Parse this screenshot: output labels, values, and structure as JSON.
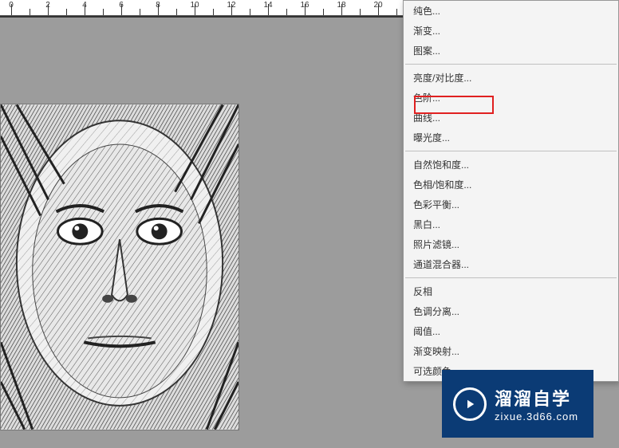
{
  "ruler": {
    "labels": [
      "0",
      "2",
      "4",
      "6",
      "8",
      "10",
      "12",
      "14",
      "16",
      "18",
      "20"
    ]
  },
  "menu": {
    "items": [
      {
        "label": "纯色...",
        "sep": false
      },
      {
        "label": "渐变...",
        "sep": false
      },
      {
        "label": "图案...",
        "sep": true
      },
      {
        "label": "亮度/对比度...",
        "sep": false
      },
      {
        "label": "色阶...",
        "sep": false
      },
      {
        "label": "曲线...",
        "sep": false,
        "highlight": true
      },
      {
        "label": "曝光度...",
        "sep": true
      },
      {
        "label": "自然饱和度...",
        "sep": false
      },
      {
        "label": "色相/饱和度...",
        "sep": false
      },
      {
        "label": "色彩平衡...",
        "sep": false
      },
      {
        "label": "黑白...",
        "sep": false
      },
      {
        "label": "照片滤镜...",
        "sep": false
      },
      {
        "label": "通道混合器...",
        "sep": true
      },
      {
        "label": "反相",
        "sep": false
      },
      {
        "label": "色调分离...",
        "sep": false
      },
      {
        "label": "阈值...",
        "sep": false
      },
      {
        "label": "渐变映射...",
        "sep": false
      },
      {
        "label": "可选颜色...",
        "sep": false
      }
    ]
  },
  "watermark": {
    "title": "溜溜自学",
    "url": "zixue.3d66.com"
  }
}
